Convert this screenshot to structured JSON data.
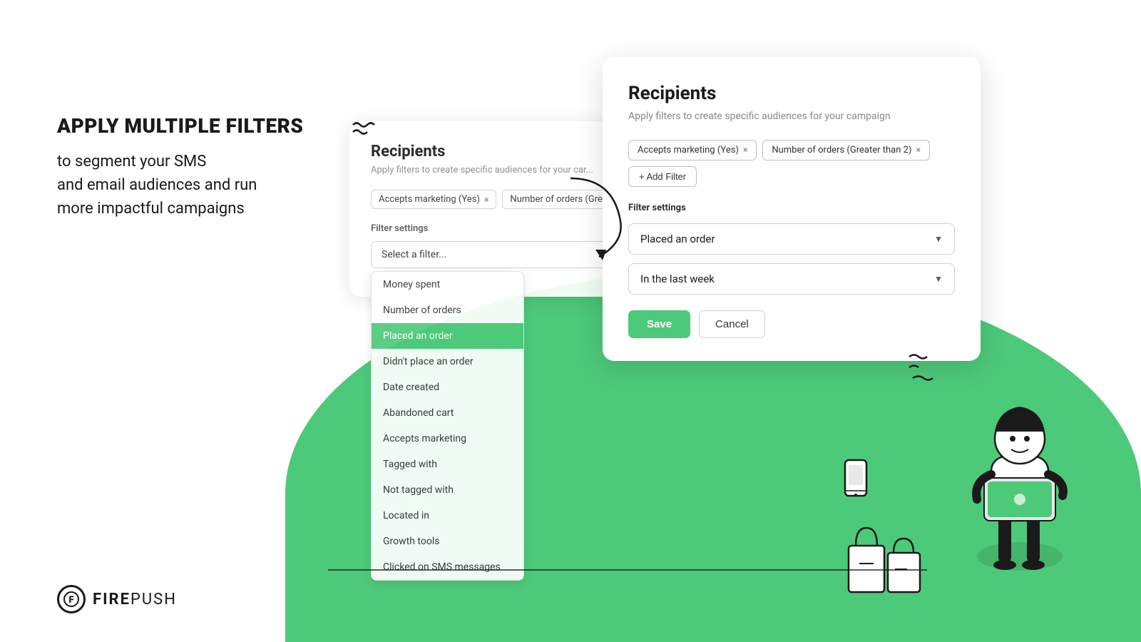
{
  "left": {
    "title": "APPLY MULTIPLE FILTERS",
    "desc_line1": "to segment your SMS",
    "desc_line2": "and email audiences and run",
    "desc_line3": "more impactful campaigns"
  },
  "logo": {
    "icon": "F",
    "fire": "FIRE",
    "push": "PUSH"
  },
  "back_card": {
    "title": "Recipients",
    "subtitle": "Apply filters to create specific audiences for your car...",
    "filter_settings": "Filter settings",
    "tags": [
      {
        "label": "Accepts marketing (Yes)",
        "id": "tag-back-1"
      },
      {
        "label": "Number of orders (Greater",
        "id": "tag-back-2"
      }
    ],
    "select_placeholder": "Select a filter...",
    "dropdown_items": [
      {
        "label": "Money spent",
        "active": false
      },
      {
        "label": "Number of orders",
        "active": false
      },
      {
        "label": "Placed an order",
        "active": true
      },
      {
        "label": "Didn't place an order",
        "active": false
      },
      {
        "label": "Date created",
        "active": false
      },
      {
        "label": "Abandoned cart",
        "active": false
      },
      {
        "label": "Accepts marketing",
        "active": false
      },
      {
        "label": "Tagged with",
        "active": false
      },
      {
        "label": "Not tagged with",
        "active": false
      },
      {
        "label": "Located in",
        "active": false
      },
      {
        "label": "Growth tools",
        "active": false
      },
      {
        "label": "Clicked on SMS messages",
        "active": false
      }
    ]
  },
  "front_card": {
    "title": "Recipients",
    "subtitle": "Apply filters to create specific audiences for your campaign",
    "filter_settings": "Filter settings",
    "tags": [
      {
        "label": "Accepts marketing (Yes)"
      },
      {
        "label": "Number of orders (Greater than 2)"
      }
    ],
    "add_filter": "+ Add Filter",
    "selected_filter": "Placed an order",
    "second_filter": "In the last week",
    "save_btn": "Save",
    "cancel_btn": "Cancel"
  }
}
